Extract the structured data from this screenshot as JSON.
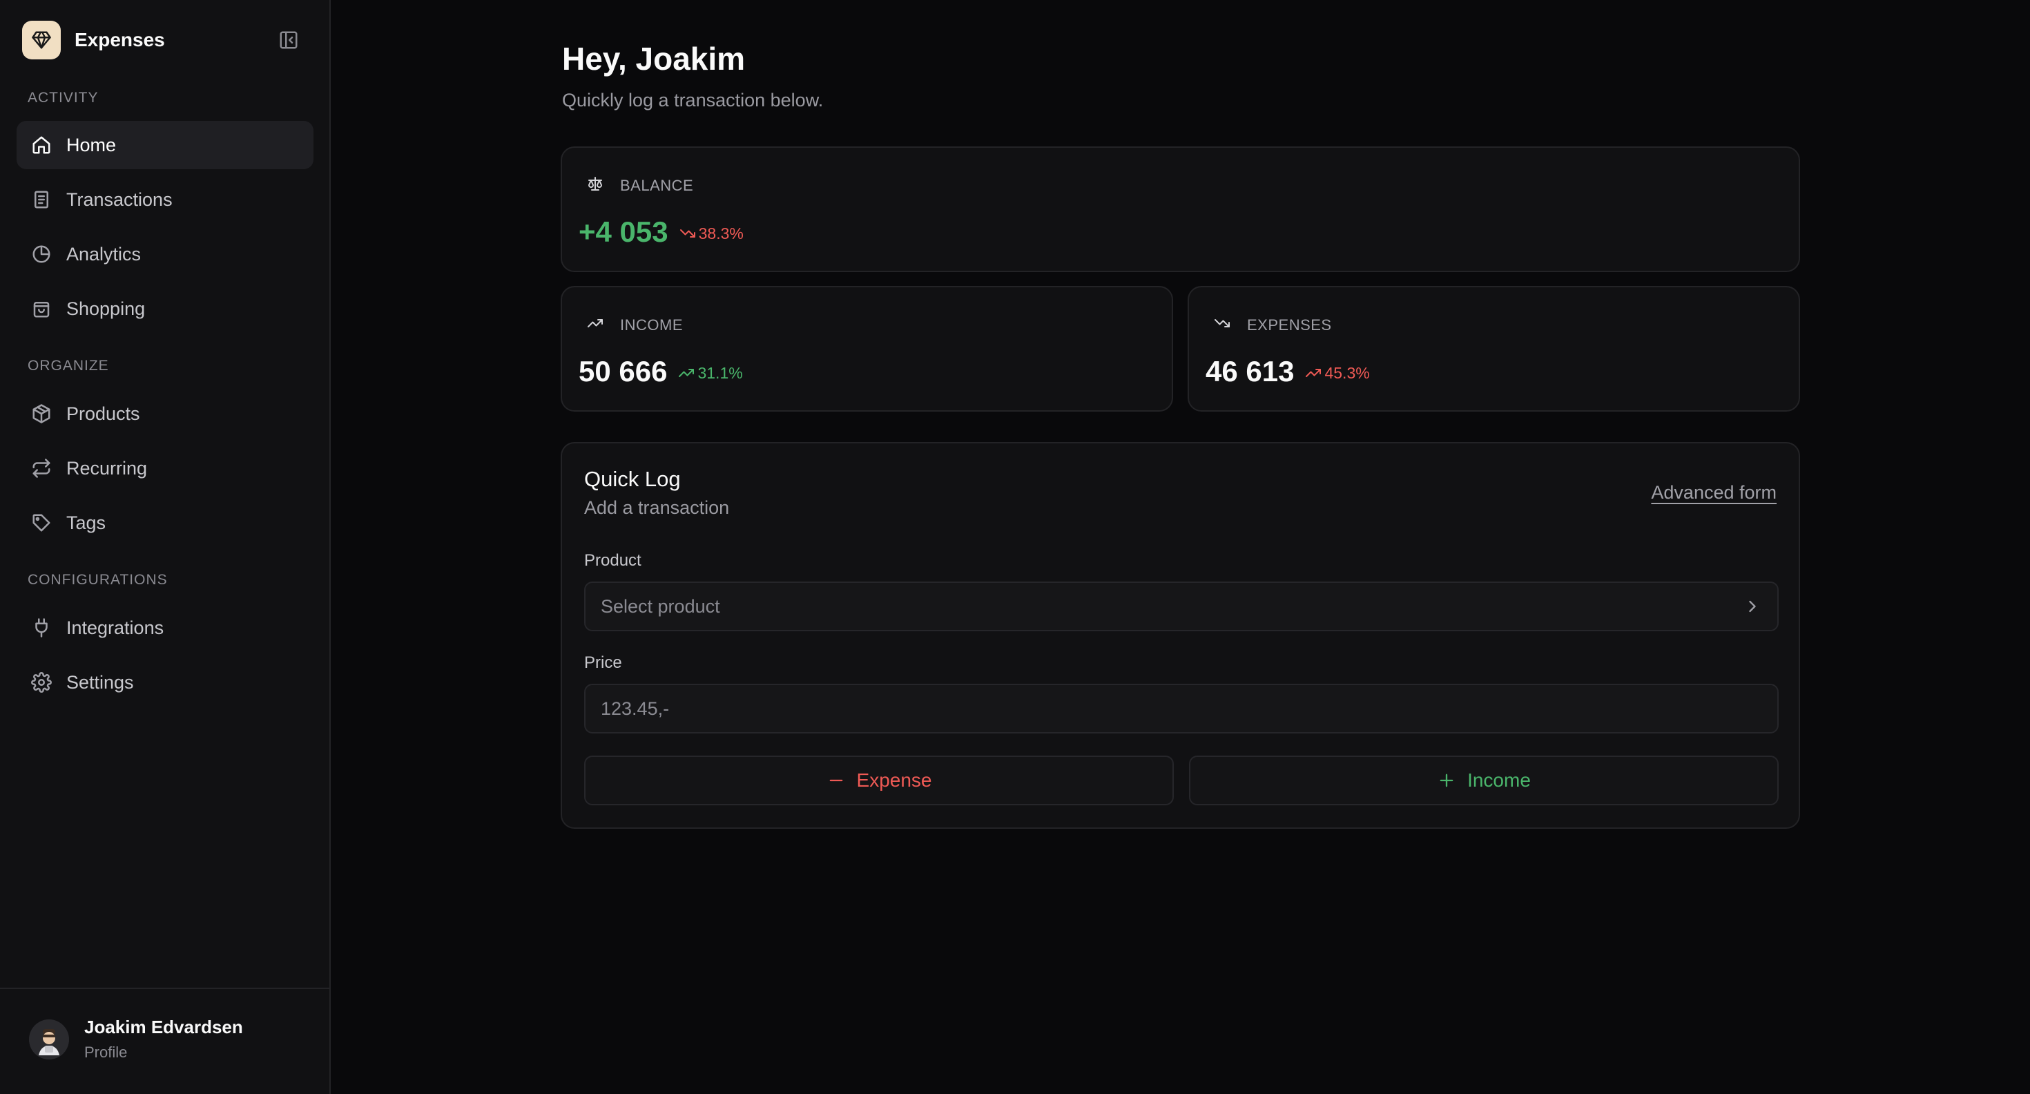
{
  "app": {
    "name": "Expenses"
  },
  "sidebar": {
    "sections": [
      {
        "label": "ACTIVITY"
      },
      {
        "label": "ORGANIZE"
      },
      {
        "label": "CONFIGURATIONS"
      }
    ],
    "items": [
      {
        "label": "Home",
        "icon": "home-icon",
        "active": true
      },
      {
        "label": "Transactions",
        "icon": "receipt-icon"
      },
      {
        "label": "Analytics",
        "icon": "pie-chart-icon"
      },
      {
        "label": "Shopping",
        "icon": "shopping-bag-icon"
      },
      {
        "label": "Products",
        "icon": "package-icon"
      },
      {
        "label": "Recurring",
        "icon": "repeat-icon"
      },
      {
        "label": "Tags",
        "icon": "tag-icon"
      },
      {
        "label": "Integrations",
        "icon": "plug-icon"
      },
      {
        "label": "Settings",
        "icon": "gear-icon"
      }
    ],
    "profile": {
      "name": "Joakim Edvardsen",
      "subtitle": "Profile"
    }
  },
  "main": {
    "greeting": "Hey, Joakim",
    "subtitle": "Quickly log a transaction below.",
    "stats": {
      "balance": {
        "label": "BALANCE",
        "value": "+4 053",
        "delta": "38.3%",
        "delta_trend": "down"
      },
      "income": {
        "label": "INCOME",
        "value": "50 666",
        "delta": "31.1%",
        "delta_trend": "up"
      },
      "expenses": {
        "label": "EXPENSES",
        "value": "46 613",
        "delta": "45.3%",
        "delta_trend": "up"
      }
    },
    "quick_log": {
      "title": "Quick Log",
      "subtitle": "Add a transaction",
      "advanced_link": "Advanced form",
      "product_label": "Product",
      "product_placeholder": "Select product",
      "price_label": "Price",
      "price_placeholder": "123.45,-",
      "expense_button": "Expense",
      "income_button": "Income"
    }
  },
  "colors": {
    "background": "#09090b",
    "sidebar": "#111113",
    "positive": "#4ab56b",
    "negative": "#ef5a55",
    "brand_logo_bg": "#f1dfc3"
  }
}
